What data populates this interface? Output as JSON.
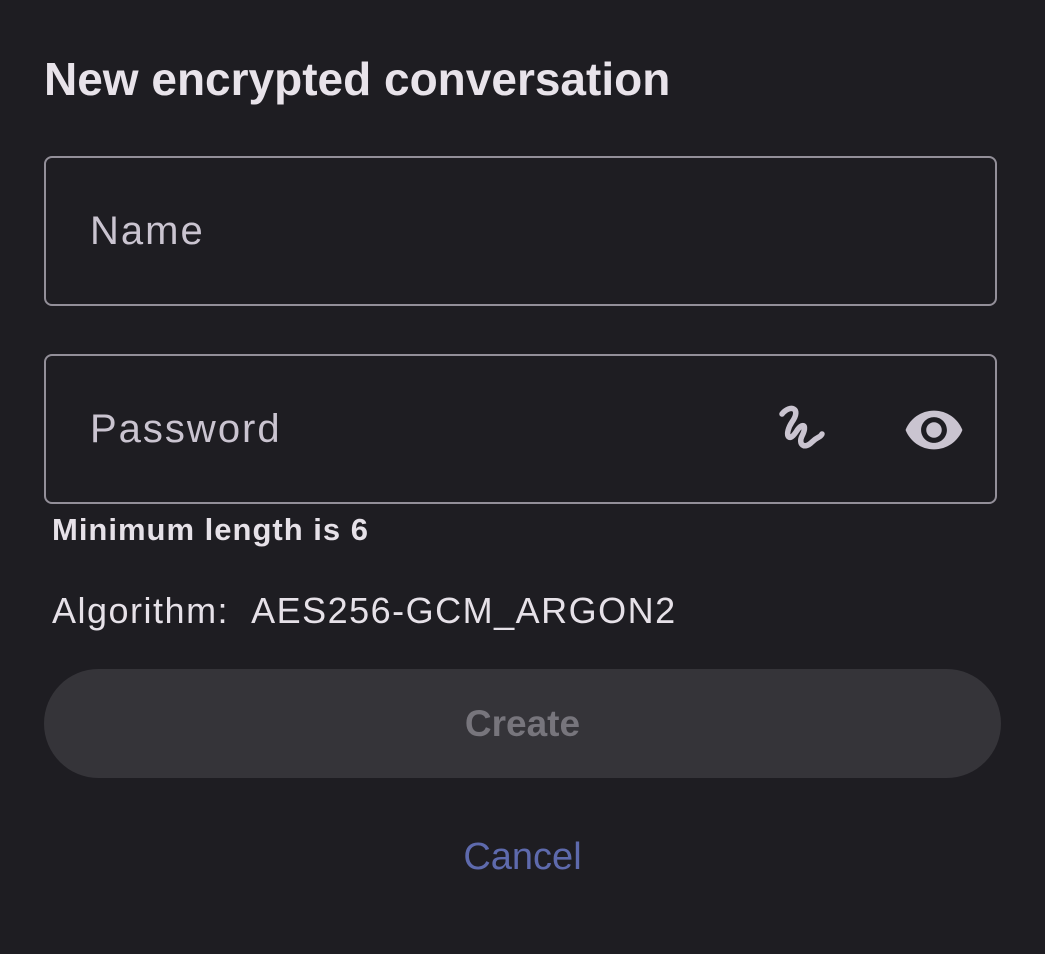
{
  "dialog": {
    "title": "New encrypted conversation",
    "name_field": {
      "placeholder": "Name",
      "value": ""
    },
    "password_field": {
      "placeholder": "Password",
      "value": "",
      "generate_icon": "password-generate-icon",
      "visibility_icon": "eye-icon"
    },
    "helper_text": "Minimum length is 6",
    "algorithm_label": "Algorithm:",
    "algorithm_value": "AES256-GCM_ARGON2",
    "create_label": "Create",
    "cancel_label": "Cancel"
  },
  "colors": {
    "background": "#1e1d22",
    "outline": "#938f99",
    "disabled_button_bg": "#353439",
    "disabled_button_text": "#77757c",
    "accent": "#5e6aad",
    "text": "#e6e1e8"
  }
}
